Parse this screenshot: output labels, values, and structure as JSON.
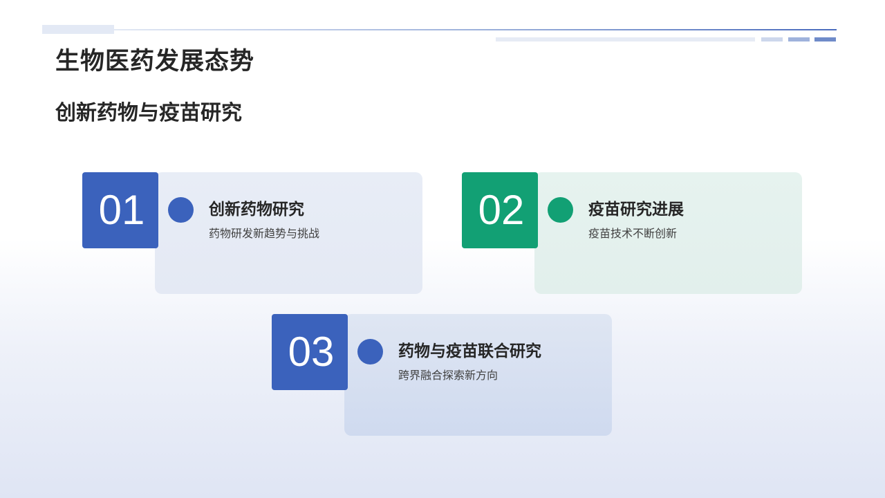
{
  "header": {
    "title": "生物医药发展态势",
    "subtitle": "创新药物与疫苗研究"
  },
  "colors": {
    "accent_blue": "#3b62bc",
    "accent_green": "#12a074",
    "text_dark": "#262626"
  },
  "cards": [
    {
      "number": "01",
      "title": "创新药物研究",
      "description": "药物研发新趋势与挑战",
      "color": "#3b62bc"
    },
    {
      "number": "02",
      "title": "疫苗研究进展",
      "description": "疫苗技术不断创新",
      "color": "#12a074"
    },
    {
      "number": "03",
      "title": "药物与疫苗联合研究",
      "description": "跨界融合探索新方向",
      "color": "#3b62bc"
    }
  ]
}
